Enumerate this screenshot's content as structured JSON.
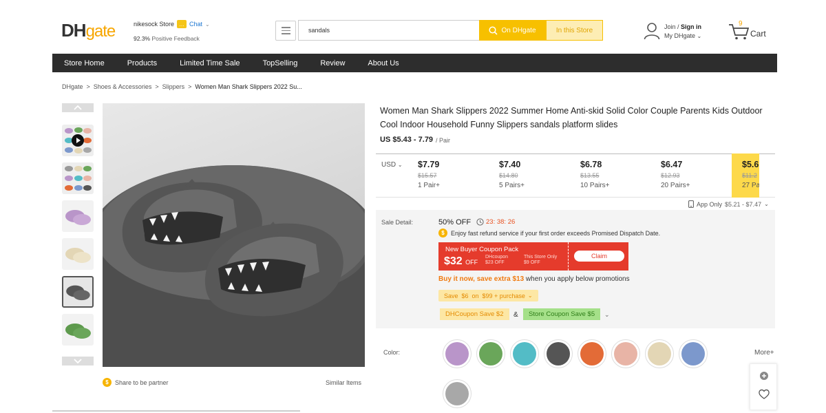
{
  "header": {
    "logo_dh": "DH",
    "logo_gate": "gate",
    "store_name": "nikesock Store",
    "chat_label": "Chat",
    "feedback_pct": "92.3%",
    "feedback_label": "Positive Feedback",
    "search_value": "sandals",
    "on_dhgate_label": "On DHgate",
    "in_store_label": "In this Store",
    "signin_join": "Join /",
    "signin_label": "Sign in",
    "my_dhgate": "My DHgate",
    "cart_count": "9",
    "cart_label": "Cart"
  },
  "nav": {
    "items": [
      "Store Home",
      "Products",
      "Limited Time Sale",
      "TopSelling",
      "Review",
      "About Us"
    ]
  },
  "breadcrumb": {
    "items": [
      "DHgate",
      "Shoes & Accessories",
      "Slippers"
    ],
    "current": "Women Man Shark Slippers 2022 Su..."
  },
  "gallery": {
    "share_label": "Share to be partner",
    "similar_label": "Similar Items"
  },
  "product": {
    "title": "Women Man Shark Slippers 2022 Summer Home Anti-skid Solid Color Couple Parents Kids Outdoor Cool Indoor Household Funny Slippers sandals platform slides",
    "price_range": "US $5.43 - 7.79",
    "price_unit": "/ Pair",
    "currency": "USD",
    "tiers": [
      {
        "price": "$7.79",
        "orig": "$15.57",
        "qty": "1 Pair+"
      },
      {
        "price": "$7.40",
        "orig": "$14.80",
        "qty": "5 Pairs+"
      },
      {
        "price": "$6.78",
        "orig": "$13.55",
        "qty": "10 Pairs+"
      },
      {
        "price": "$6.47",
        "orig": "$12.93",
        "qty": "20 Pairs+"
      },
      {
        "price": "$5.6",
        "orig": "$11.2",
        "qty": "27 Pa"
      }
    ],
    "app_only_label": "App Only",
    "app_only_range": "$5.21 - $7.47"
  },
  "sale": {
    "label": "Sale Detail:",
    "off": "50% OFF",
    "timer": "23: 38: 26",
    "refund_text": "Enjoy fast refund service if your first order exceeds Promised Dispatch Date.",
    "coupon_title": "New Buyer Coupon Pack",
    "coupon_amount": "$32",
    "coupon_off": "OFF",
    "coupon_dh_line1": "DHcoupon",
    "coupon_dh_line2": "$23 OFF",
    "coupon_store_line1": "This Store Only",
    "coupon_store_line2": "$9 OFF",
    "claim_label": "Claim",
    "buy_now_prefix": "Buy it now, save extra",
    "buy_now_amount": "$13",
    "buy_now_suffix": "when you apply below promotions",
    "save_pill": "Save  $6  on  $99 + purchase",
    "dh_coupon": "DHCoupon Save $2",
    "amp": "&",
    "store_coupon": "Store Coupon Save $5"
  },
  "colors": {
    "label": "Color:",
    "more_label": "More+",
    "swatches": [
      "#b995c9",
      "#6aa65a",
      "#53bcc6",
      "#555555",
      "#e36b37",
      "#e8b4a6",
      "#e3d6b5",
      "#7c98cc",
      "#a8a8a8"
    ]
  },
  "accent": "#f7c000"
}
